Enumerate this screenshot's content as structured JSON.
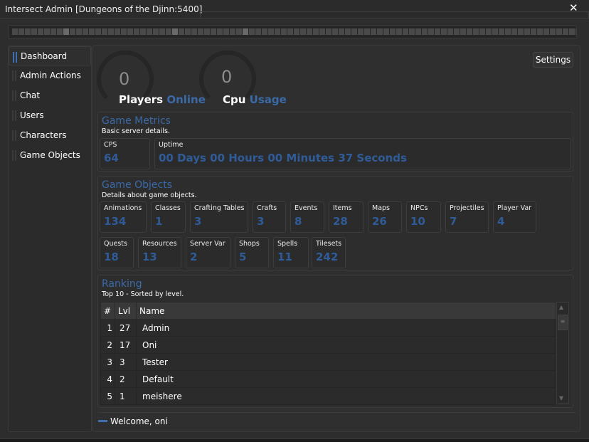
{
  "window": {
    "title": "Intersect Admin [Dungeons of the Djinn:5400]",
    "close": "✕"
  },
  "sidebar": {
    "items": [
      {
        "label": "Dashboard",
        "active": true
      },
      {
        "label": "Admin Actions"
      },
      {
        "label": "Chat"
      },
      {
        "label": "Users"
      },
      {
        "label": "Characters"
      },
      {
        "label": "Game Objects"
      }
    ]
  },
  "gauges": {
    "players": {
      "value": "0",
      "label": "Players",
      "sub": "Online"
    },
    "cpu": {
      "value": "0",
      "label": "Cpu",
      "sub": "Usage"
    }
  },
  "settings_label": "Settings",
  "metrics": {
    "title": "Game Metrics",
    "subtitle": "Basic server details.",
    "cps_label": "CPS",
    "cps": "64",
    "uptime_label": "Uptime",
    "uptime": "00 Days 00 Hours 00 Minutes 37 Seconds"
  },
  "objects": {
    "title": "Game Objects",
    "subtitle": "Details about game objects.",
    "items": [
      {
        "label": "Animations",
        "value": "134"
      },
      {
        "label": "Classes",
        "value": "1"
      },
      {
        "label": "Crafting Tables",
        "value": "3"
      },
      {
        "label": "Crafts",
        "value": "3"
      },
      {
        "label": "Events",
        "value": "8"
      },
      {
        "label": "Items",
        "value": "28"
      },
      {
        "label": "Maps",
        "value": "26"
      },
      {
        "label": "NPCs",
        "value": "10"
      },
      {
        "label": "Projectiles",
        "value": "7"
      },
      {
        "label": "Player Var",
        "value": "4"
      },
      {
        "label": "Quests",
        "value": "18"
      },
      {
        "label": "Resources",
        "value": "13"
      },
      {
        "label": "Server Var",
        "value": "2"
      },
      {
        "label": "Shops",
        "value": "5"
      },
      {
        "label": "Spells",
        "value": "11"
      },
      {
        "label": "Tilesets",
        "value": "242"
      }
    ]
  },
  "ranking": {
    "title": "Ranking",
    "subtitle": "Top 10 - Sorted by level.",
    "columns": [
      "#",
      "Lvl",
      "Name"
    ],
    "rows": [
      [
        "1",
        "27",
        "Admin"
      ],
      [
        "2",
        "17",
        "Oni"
      ],
      [
        "3",
        "3",
        "Tester"
      ],
      [
        "4",
        "2",
        "Default"
      ],
      [
        "5",
        "1",
        "meishere"
      ]
    ]
  },
  "status": {
    "welcome": "Welcome, oni"
  },
  "colors": {
    "accent": "#3a6aa8",
    "background": "#2d2d2d"
  }
}
